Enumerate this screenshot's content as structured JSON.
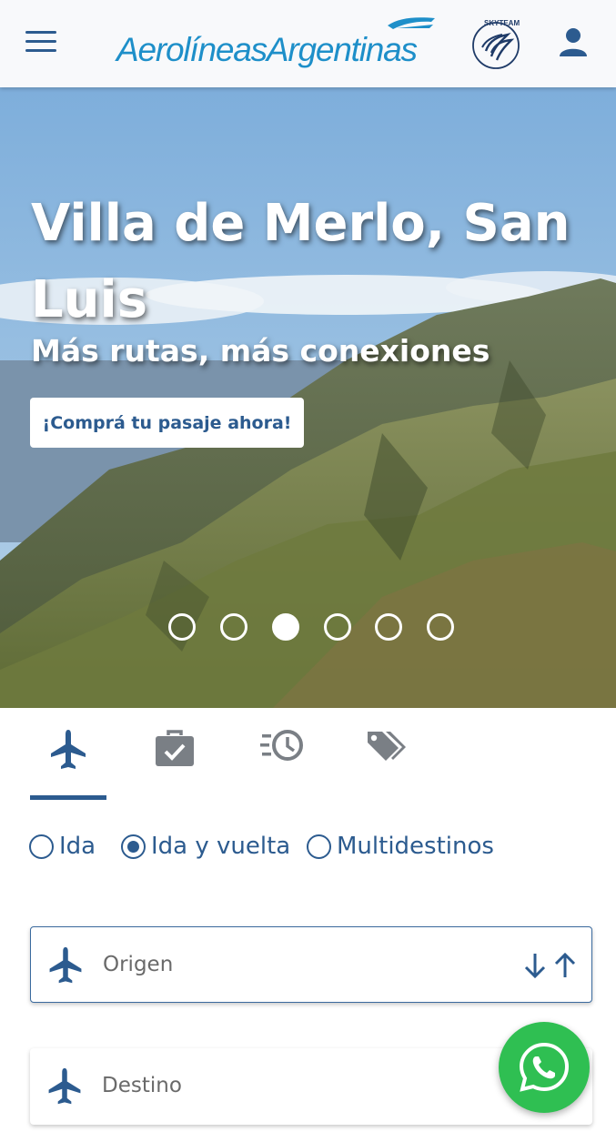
{
  "header": {
    "logo_text": "AerolíneasArgentinas",
    "alliance_logo_text": "SKYTEAM"
  },
  "hero": {
    "title": "Villa de Merlo, San Luis",
    "subtitle": "Más rutas, más conexiones",
    "cta_label": "¡Comprá tu pasaje ahora!",
    "slide_count": 6,
    "active_slide": 3
  },
  "tabs": [
    {
      "icon": "airplane-icon",
      "selected": true
    },
    {
      "icon": "briefcase-check-icon",
      "selected": false
    },
    {
      "icon": "clock-history-icon",
      "selected": false
    },
    {
      "icon": "tags-icon",
      "selected": false
    }
  ],
  "trip_type": {
    "options": [
      "Ida",
      "Ida y vuelta",
      "Multidestinos"
    ],
    "selected": "Ida y vuelta"
  },
  "search": {
    "origin_placeholder": "Origen",
    "destination_placeholder": "Destino"
  },
  "colors": {
    "primary": "#2c5b8f",
    "logo_blue": "#1e8fc9",
    "whatsapp_green": "#2fbf52"
  }
}
